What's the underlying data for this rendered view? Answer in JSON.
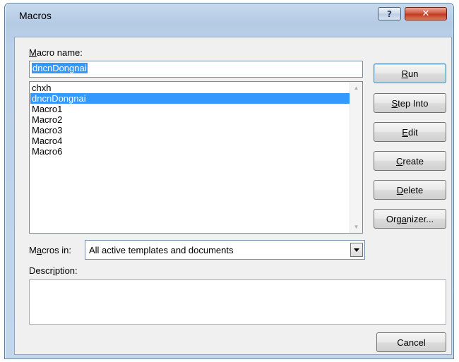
{
  "window": {
    "title": "Macros",
    "help_glyph": "?",
    "close_glyph": "✕"
  },
  "macro_name": {
    "label_underlined": "M",
    "label_rest": "acro name:",
    "value": "dncnDongnai"
  },
  "macro_list": {
    "items": [
      "chxh",
      "dncnDongnai",
      "Macro1",
      "Macro2",
      "Macro3",
      "Macro4",
      "Macro6"
    ],
    "selected_index": 1
  },
  "buttons": {
    "run": {
      "pre": "",
      "u": "R",
      "post": "un"
    },
    "step_into": {
      "pre": "",
      "u": "S",
      "post": "tep Into"
    },
    "edit": {
      "pre": "",
      "u": "E",
      "post": "dit"
    },
    "create": {
      "pre": "",
      "u": "C",
      "post": "reate"
    },
    "delete": {
      "pre": "",
      "u": "D",
      "post": "elete"
    },
    "organizer": {
      "pre": "Org",
      "u": "a",
      "post": "nizer..."
    },
    "cancel": "Cancel"
  },
  "macros_in": {
    "label_pre": "M",
    "label_u": "a",
    "label_post": "cros in:",
    "value": "All active templates and documents"
  },
  "description": {
    "label_pre": "Descr",
    "label_u": "i",
    "label_post": "ption:",
    "value": ""
  },
  "icons": {
    "scroll_up": "▲",
    "scroll_down": "▼"
  }
}
